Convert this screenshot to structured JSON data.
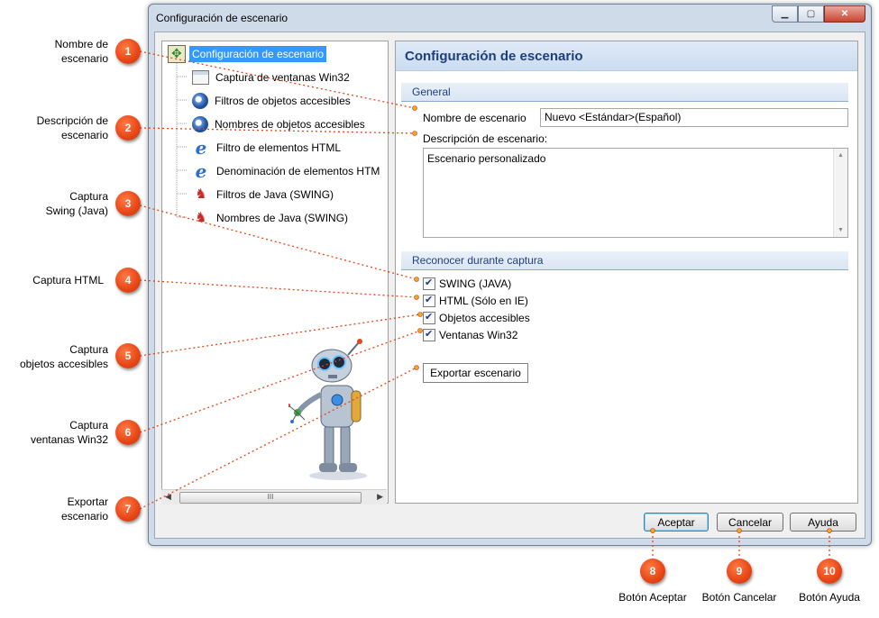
{
  "window": {
    "title": "Configuración de escenario",
    "controls": [
      "minimize",
      "maximize",
      "close"
    ]
  },
  "tree": {
    "items": [
      {
        "label": "Configuración de escenario",
        "icon": "scenario-config-icon",
        "selected": true
      },
      {
        "label": "Captura de ventanas Win32",
        "icon": "window-icon"
      },
      {
        "label": "Filtros de objetos accesibles",
        "icon": "accessible-icon"
      },
      {
        "label": "Nombres de objetos accesibles",
        "icon": "accessible-icon"
      },
      {
        "label": "Filtro de elementos HTML",
        "icon": "ie-icon"
      },
      {
        "label": "Denominación de elementos HTM",
        "icon": "ie-icon"
      },
      {
        "label": "Filtros de Java (SWING)",
        "icon": "java-icon"
      },
      {
        "label": "Nombres de Java (SWING)",
        "icon": "java-icon"
      }
    ],
    "hscroll_grip": "III"
  },
  "panel": {
    "title": "Configuración de escenario",
    "general_section": "General",
    "name_label": "Nombre de escenario",
    "name_value": "Nuevo <Estándar>(Español)",
    "desc_label": "Descripción de escenario:",
    "desc_value": "Escenario personalizado",
    "capture_section": "Reconocer durante captura",
    "checkboxes": [
      {
        "label": "SWING (JAVA)",
        "checked": true
      },
      {
        "label": "HTML (Sólo en IE)",
        "checked": true
      },
      {
        "label": "Objetos accesibles",
        "checked": true
      },
      {
        "label": "Ventanas Win32",
        "checked": true
      }
    ],
    "export_button": "Exportar escenario"
  },
  "footer": {
    "ok": "Aceptar",
    "cancel": "Cancelar",
    "help": "Ayuda"
  },
  "callouts": [
    {
      "num": "1",
      "text": [
        "Nombre de",
        "escenario"
      ]
    },
    {
      "num": "2",
      "text": [
        "Descripción de",
        "escenario"
      ]
    },
    {
      "num": "3",
      "text": [
        "Captura",
        "Swing (Java)"
      ]
    },
    {
      "num": "4",
      "text": [
        "Captura HTML"
      ]
    },
    {
      "num": "5",
      "text": [
        "Captura",
        "objetos accesibles"
      ]
    },
    {
      "num": "6",
      "text": [
        "Captura",
        "ventanas Win32"
      ]
    },
    {
      "num": "7",
      "text": [
        "Exportar",
        "escenario"
      ]
    },
    {
      "num": "8",
      "text": [
        "Botón Aceptar"
      ]
    },
    {
      "num": "9",
      "text": [
        "Botón Cancelar"
      ]
    },
    {
      "num": "10",
      "text": [
        "Botón Ayuda"
      ]
    }
  ],
  "colors": {
    "callout_badge": "#e64515",
    "callout_line": "#e64515",
    "selection": "#3399ff",
    "panel_title": "#1f3f7a"
  }
}
